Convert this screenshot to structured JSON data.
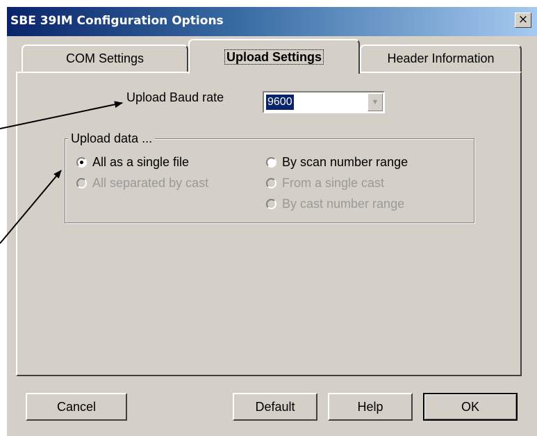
{
  "window": {
    "title": "SBE 39IM Configuration Options",
    "close_glyph": "×"
  },
  "tabs": [
    {
      "label": "COM Settings",
      "active": false
    },
    {
      "label": "Upload Settings",
      "active": true
    },
    {
      "label": "Header Information",
      "active": false
    }
  ],
  "upload": {
    "baud_label": "Upload Baud rate",
    "baud_value": "9600",
    "group_label": "Upload data ...",
    "options": {
      "single_file": {
        "label": "All as a single file",
        "checked": true,
        "enabled": true
      },
      "scan_range": {
        "label": "By scan number range",
        "checked": false,
        "enabled": true
      },
      "separated_by_cast": {
        "label": "All separated by cast",
        "checked": false,
        "enabled": false
      },
      "single_cast": {
        "label": "From a single cast",
        "checked": false,
        "enabled": false
      },
      "cast_range": {
        "label": "By cast number range",
        "checked": false,
        "enabled": false
      }
    }
  },
  "buttons": {
    "cancel": "Cancel",
    "default": "Default",
    "help": "Help",
    "ok": "OK"
  },
  "colors": {
    "titlebar_start": "#0a246a",
    "titlebar_end": "#a6caf0",
    "face": "#d4d0c8"
  }
}
